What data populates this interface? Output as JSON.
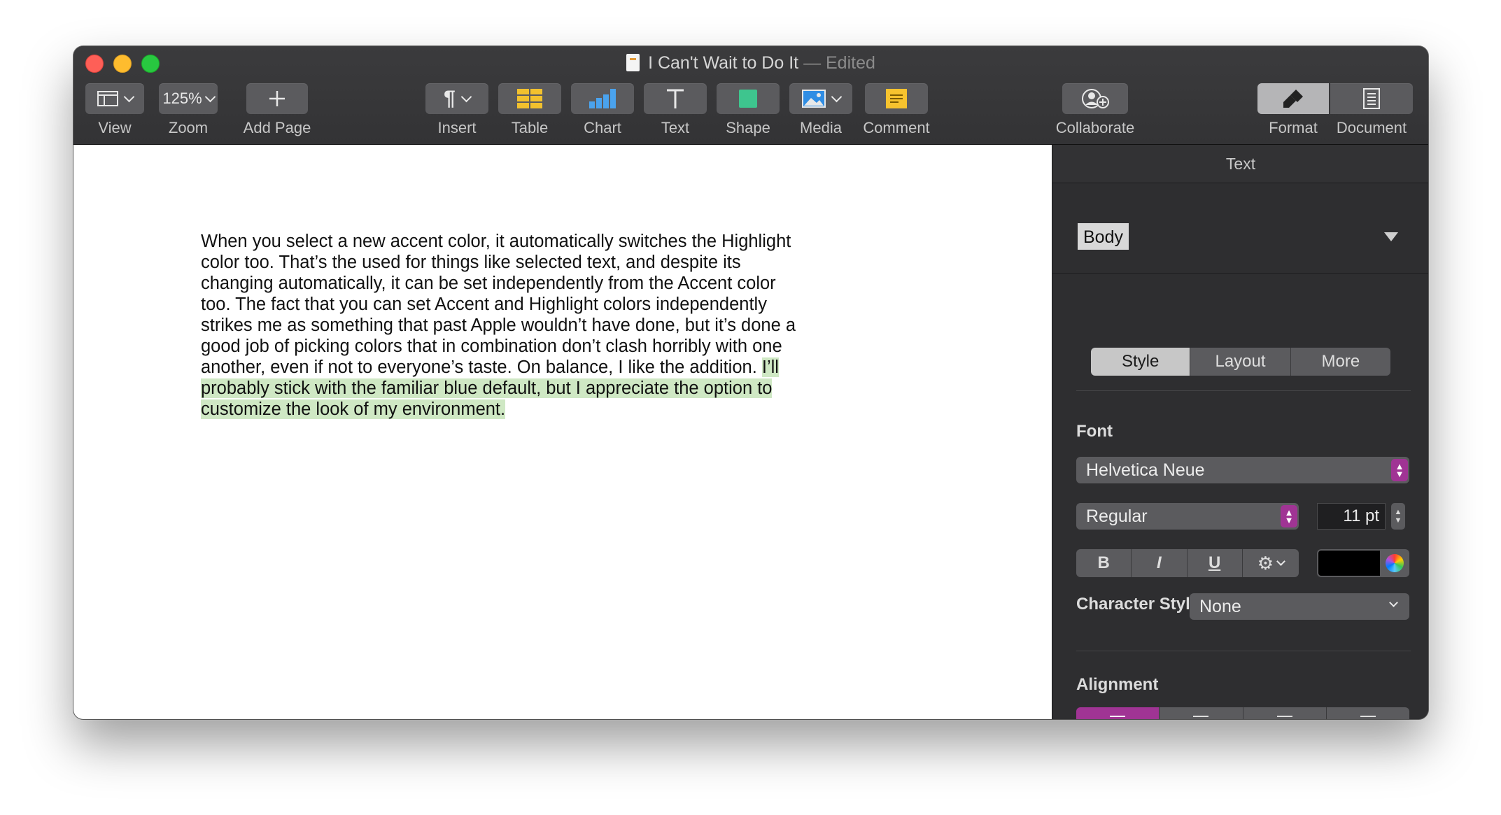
{
  "window": {
    "title": "I Can't Wait to Do It",
    "title_status": "— Edited"
  },
  "toolbar": {
    "view_label": "View",
    "zoom_value": "125%",
    "zoom_label": "Zoom",
    "add_page_label": "Add Page",
    "insert_label": "Insert",
    "table_label": "Table",
    "chart_label": "Chart",
    "text_label": "Text",
    "shape_label": "Shape",
    "media_label": "Media",
    "comment_label": "Comment",
    "collaborate_label": "Collaborate",
    "format_label": "Format",
    "document_label": "Document"
  },
  "document": {
    "body_plain": "When you select a new accent color, it automatically switches the Highlight color too. That’s the used for things like selected text, and despite its changing automatically, it can be set independently from the Accent color too. The fact that you can set Accent and Highlight colors independently strikes me as something that past Apple wouldn’t have done, but it’s done a good job of picking colors that in combination don’t clash horribly with one another, even if not to everyone’s taste. On balance, I like the addition. ",
    "body_highlighted": "I’ll probably stick with the familiar blue default, but I appreciate the option to customize the look of my environment. "
  },
  "sidebar": {
    "header": "Text",
    "paragraph_style": "Body",
    "tabs": [
      "Style",
      "Layout",
      "More"
    ],
    "font_section": "Font",
    "font_family": "Helvetica Neue",
    "font_typeface": "Regular",
    "font_size": "11 pt",
    "bold": "B",
    "italic": "I",
    "underline": "U",
    "gear": "⚙",
    "character_styles_label": "Character Styles",
    "character_styles_value": "None",
    "alignment_section": "Alignment"
  },
  "colors": {
    "accent": "#a03494",
    "highlight": "#cfe8c4",
    "text_color_swatch": "#000000"
  }
}
